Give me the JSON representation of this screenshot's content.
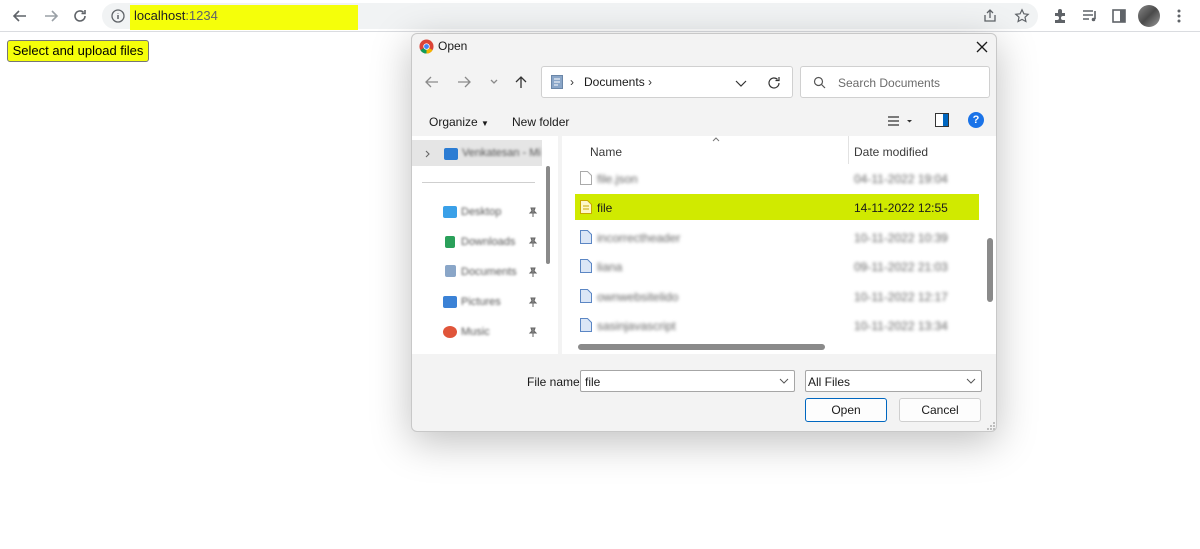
{
  "browser": {
    "url_host": "localhost",
    "url_port": ":1234"
  },
  "page": {
    "upload_button": "Select and upload files"
  },
  "dialog": {
    "title": "Open",
    "path": "Documents",
    "search_placeholder": "Search Documents",
    "organize": "Organize",
    "new_folder": "New folder",
    "help": "?",
    "nav_items": [
      {
        "label": "Venkatesan - Mi",
        "icon": "cloud-icon"
      },
      {
        "label": "Desktop",
        "icon": "desktop-icon"
      },
      {
        "label": "Downloads",
        "icon": "download-icon"
      },
      {
        "label": "Documents",
        "icon": "documents-icon"
      },
      {
        "label": "Pictures",
        "icon": "pictures-icon"
      },
      {
        "label": "Music",
        "icon": "music-icon"
      }
    ],
    "columns": {
      "name": "Name",
      "date": "Date modified"
    },
    "files": [
      {
        "name": "file.json",
        "date": "04-11-2022 19:04"
      },
      {
        "name": "file",
        "date": "14-11-2022 12:55"
      },
      {
        "name": "incorrectheader",
        "date": "10-11-2022 10:39"
      },
      {
        "name": "liana",
        "date": "09-11-2022 21:03"
      },
      {
        "name": "ownwebsitelido",
        "date": "10-11-2022 12:17"
      },
      {
        "name": "sasinjavascript",
        "date": "10-11-2022 13:34"
      }
    ],
    "file_name_label": "File name:",
    "file_name_value": "file",
    "file_type": "All Files",
    "open_button": "Open",
    "cancel_button": "Cancel"
  },
  "colors": {
    "highlight": "#f5ff0a",
    "selected_row": "#d0ea00",
    "accent": "#0067c0"
  }
}
